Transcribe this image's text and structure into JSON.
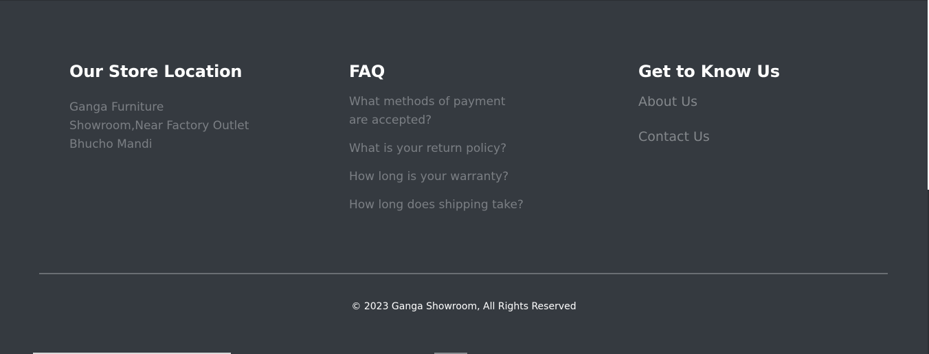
{
  "store": {
    "heading": "Our Store Location",
    "address": "Ganga Furniture Showroom,Near Factory Outlet Bhucho Mandi"
  },
  "faq": {
    "heading": "FAQ",
    "items": [
      "What methods of payment are accepted?",
      "What is your return policy?",
      "How long is your warranty?",
      "How long does shipping take?"
    ]
  },
  "know": {
    "heading": "Get to Know Us",
    "links": [
      "About Us",
      "Contact Us"
    ]
  },
  "footer": {
    "copyright": "© 2023 Ganga Showroom, All Rights Reserved"
  },
  "colors": {
    "background": "#353a40",
    "heading": "#ffffff",
    "muted_text": "#7b7f84",
    "divider": "#6a6e73"
  }
}
